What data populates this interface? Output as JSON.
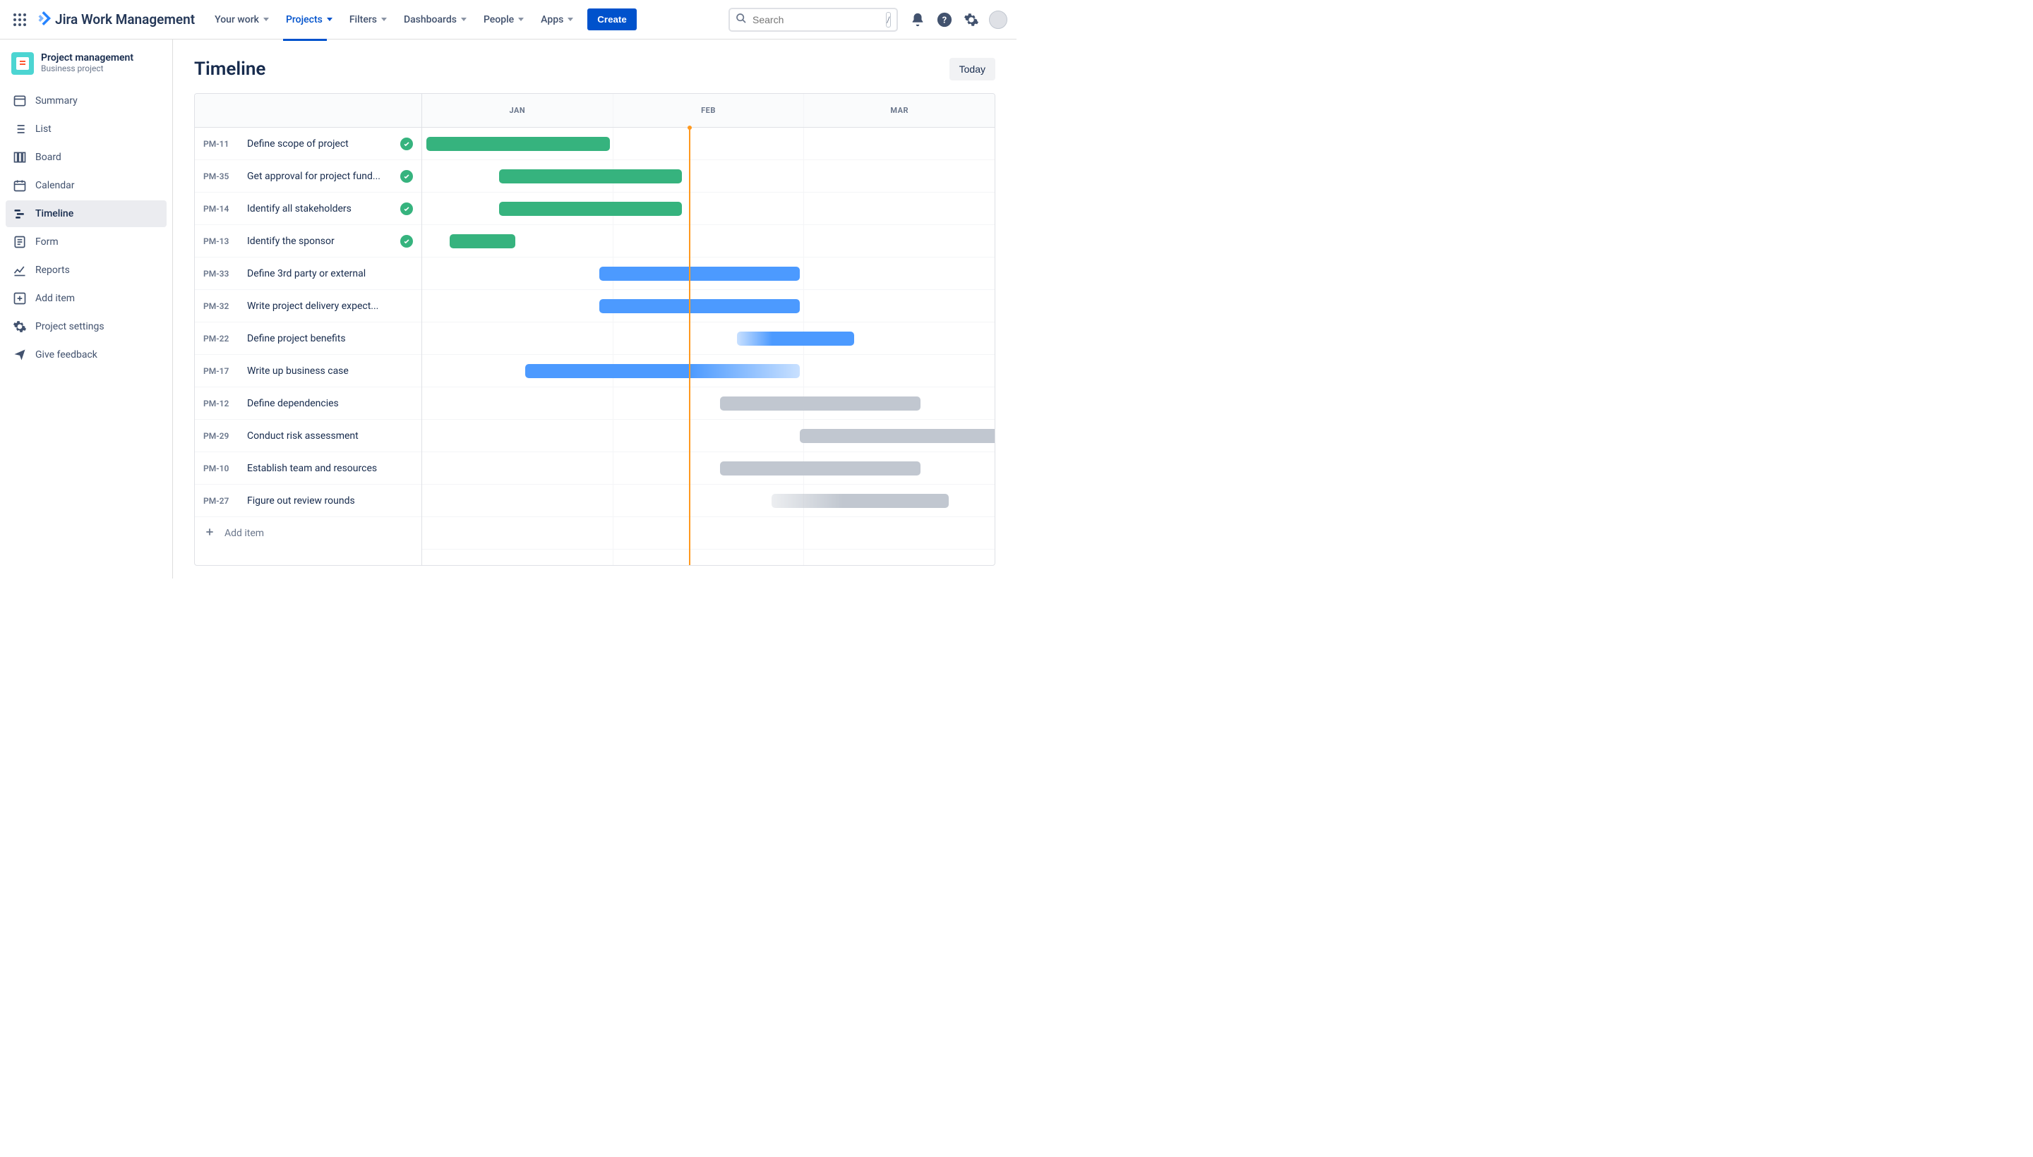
{
  "topnav": {
    "product": "Jira Work Management",
    "items": [
      "Your work",
      "Projects",
      "Filters",
      "Dashboards",
      "People",
      "Apps"
    ],
    "active_index": 1,
    "create": "Create",
    "search_placeholder": "Search",
    "slash": "/"
  },
  "project": {
    "name": "Project management",
    "type": "Business project"
  },
  "sidebar": {
    "items": [
      {
        "label": "Summary",
        "icon": "summary"
      },
      {
        "label": "List",
        "icon": "list"
      },
      {
        "label": "Board",
        "icon": "board"
      },
      {
        "label": "Calendar",
        "icon": "calendar"
      },
      {
        "label": "Timeline",
        "icon": "timeline"
      },
      {
        "label": "Form",
        "icon": "form"
      },
      {
        "label": "Reports",
        "icon": "reports"
      },
      {
        "label": "Add item",
        "icon": "add-item"
      },
      {
        "label": "Project settings",
        "icon": "settings"
      },
      {
        "label": "Give feedback",
        "icon": "feedback"
      }
    ],
    "active_index": 4
  },
  "page": {
    "title": "Timeline",
    "today_btn": "Today",
    "add_item": "Add item"
  },
  "timeline": {
    "months": [
      "JAN",
      "FEB",
      "MAR"
    ],
    "today_position_pct": 46.6,
    "tasks": [
      {
        "key": "PM-11",
        "title": "Define scope of project",
        "done": true,
        "bar": {
          "start": 0.8,
          "width": 32,
          "style": "green"
        }
      },
      {
        "key": "PM-35",
        "title": "Get approval for project fund...",
        "done": true,
        "bar": {
          "start": 13.4,
          "width": 32,
          "style": "green"
        }
      },
      {
        "key": "PM-14",
        "title": "Identify all stakeholders",
        "done": true,
        "bar": {
          "start": 13.4,
          "width": 32,
          "style": "green"
        }
      },
      {
        "key": "PM-13",
        "title": "Identify the sponsor",
        "done": true,
        "bar": {
          "start": 4.8,
          "width": 11.5,
          "style": "green"
        }
      },
      {
        "key": "PM-33",
        "title": "Define 3rd party or external",
        "done": false,
        "bar": {
          "start": 31,
          "width": 35,
          "style": "blue"
        }
      },
      {
        "key": "PM-32",
        "title": "Write project delivery expect...",
        "done": false,
        "bar": {
          "start": 31,
          "width": 35,
          "style": "blue"
        }
      },
      {
        "key": "PM-22",
        "title": "Define project benefits",
        "done": false,
        "bar": {
          "start": 55,
          "width": 20.5,
          "style": "blue-grad-left"
        }
      },
      {
        "key": "PM-17",
        "title": "Write up business case",
        "done": false,
        "bar": {
          "start": 18,
          "width": 48,
          "style": "blue-grad"
        }
      },
      {
        "key": "PM-12",
        "title": "Define dependencies",
        "done": false,
        "bar": {
          "start": 52,
          "width": 35,
          "style": "gray"
        }
      },
      {
        "key": "PM-29",
        "title": "Conduct risk assessment",
        "done": false,
        "bar": {
          "start": 66,
          "width": 35,
          "style": "gray"
        }
      },
      {
        "key": "PM-10",
        "title": "Establish team and resources",
        "done": false,
        "bar": {
          "start": 52,
          "width": 35,
          "style": "gray"
        }
      },
      {
        "key": "PM-27",
        "title": "Figure out review rounds",
        "done": false,
        "bar": {
          "start": 61,
          "width": 31,
          "style": "gray-grad"
        }
      }
    ]
  }
}
